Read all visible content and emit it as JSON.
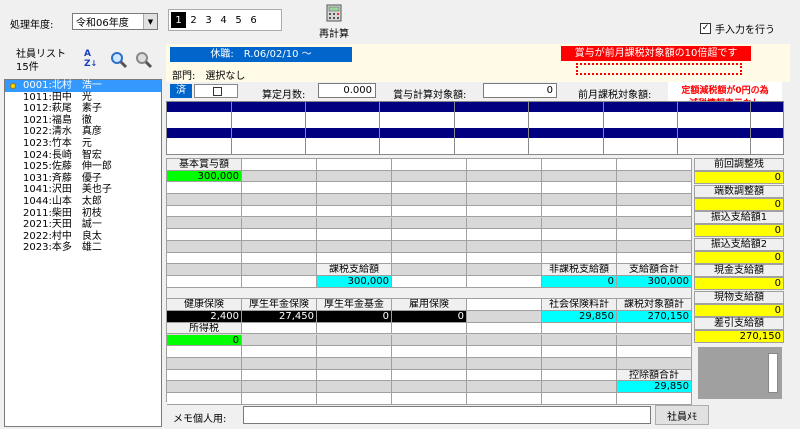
{
  "toolbar": {
    "year_label": "処理年度:",
    "year_value": "令和06年度",
    "pages": [
      "1",
      "2",
      "3",
      "4",
      "5",
      "6"
    ],
    "current_page": "1",
    "recalc_label": "再計算",
    "manual_input_label": "手入力を行う",
    "manual_input_checked": true
  },
  "sidebar": {
    "title": "社員リスト",
    "count": "15件",
    "employees": [
      {
        "code": "0001:",
        "name": "北村　浩一",
        "selected": true
      },
      {
        "code": "1011:",
        "name": "田中　光",
        "selected": false
      },
      {
        "code": "1012:",
        "name": "萩尾　素子",
        "selected": false
      },
      {
        "code": "1021:",
        "name": "福島　徹",
        "selected": false
      },
      {
        "code": "1022:",
        "name": "清水　真彦",
        "selected": false
      },
      {
        "code": "1023:",
        "name": "竹本　元",
        "selected": false
      },
      {
        "code": "1024:",
        "name": "長崎　智宏",
        "selected": false
      },
      {
        "code": "1025:",
        "name": "佐藤　伸一郎",
        "selected": false
      },
      {
        "code": "1031:",
        "name": "斉藤　優子",
        "selected": false
      },
      {
        "code": "1041:",
        "name": "沢田　美也子",
        "selected": false
      },
      {
        "code": "1044:",
        "name": "山本　太郎",
        "selected": false
      },
      {
        "code": "2011:",
        "name": "柴田　初枝",
        "selected": false
      },
      {
        "code": "2021:",
        "name": "天田　誠一",
        "selected": false
      },
      {
        "code": "2022:",
        "name": "村中　良太",
        "selected": false
      },
      {
        "code": "2023:",
        "name": "本多　雄二",
        "selected": false
      }
    ]
  },
  "header": {
    "leave_status": "休職:　R.06/02/10 ～",
    "dept": "部門:　選択なし",
    "warning": "賞与が前月課税対象額の10倍超です",
    "done_label": "済",
    "months_label": "算定月数:",
    "months_value": "0.000",
    "calc_target_label": "賞与計算対象額:",
    "calc_target_value": "0",
    "prev_month_label": "前月課税対象額:",
    "notice_line1": "定額減税額が0円の為",
    "notice_line2": "減税情報表示なし"
  },
  "grid": {
    "base_bonus_label": "基本賞与額",
    "base_bonus_value": "300,000",
    "taxable_label": "課税支給額",
    "taxable_value": "300,000",
    "nontaxable_label": "非課税支給額",
    "nontaxable_value": "0",
    "total_pay_label": "支給額合計",
    "total_pay_value": "300,000",
    "health_label": "健康保険",
    "health_value": "2,400",
    "pension_label": "厚生年金保険",
    "pension_value": "27,450",
    "pension_fund_label": "厚生年金基金",
    "pension_fund_value": "0",
    "employment_label": "雇用保険",
    "employment_value": "0",
    "social_total_label": "社会保険料計",
    "social_total_value": "29,850",
    "tax_target_label": "課税対象額計",
    "tax_target_value": "270,150",
    "income_tax_label": "所得税",
    "income_tax_value": "0",
    "deduct_total_label": "控除額合計",
    "deduct_total_value": "29,850"
  },
  "right_panel": [
    {
      "label": "前回調整残",
      "value": "0"
    },
    {
      "label": "端数調整額",
      "value": "0"
    },
    {
      "label": "振込支給額1",
      "value": "0"
    },
    {
      "label": "振込支給額2",
      "value": "0"
    },
    {
      "label": "現金支給額",
      "value": "0"
    },
    {
      "label": "現物支給額",
      "value": "0"
    },
    {
      "label": "差引支給額",
      "value": "270,150"
    }
  ],
  "footer": {
    "memo_label": "メモ個人用:",
    "memo_value": "",
    "memo_button": "社員ﾒﾓ"
  },
  "colors": {
    "navy": "#000080",
    "yellow": "#ffff00",
    "cyan": "#00ffff",
    "green": "#00ff00",
    "red": "#ff0000",
    "blue": "#0066cc"
  }
}
